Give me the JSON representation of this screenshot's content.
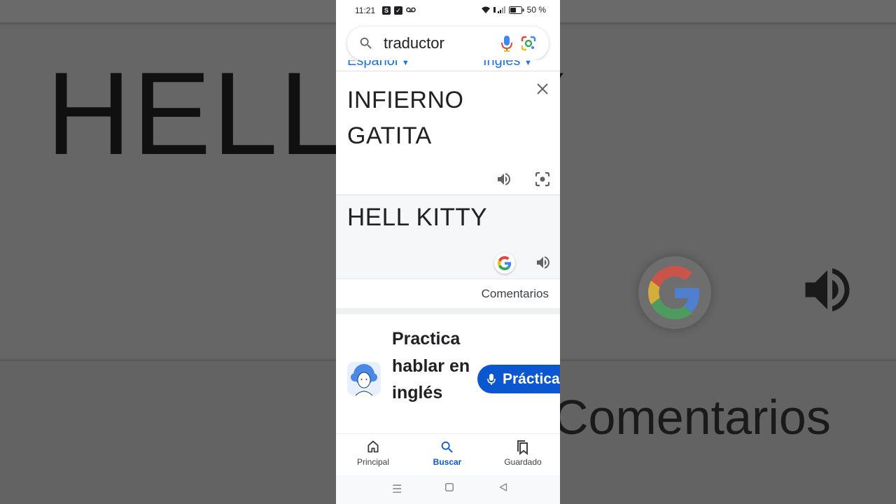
{
  "status": {
    "time": "11:21",
    "battery": "50 %"
  },
  "search": {
    "query": "traductor"
  },
  "translator": {
    "source_lang": "Español",
    "target_lang": "Inglés",
    "source_text": "INFIERNO GATITA",
    "target_text": "HELL KITTY",
    "comments_label": "Comentarios"
  },
  "practice": {
    "title": "Practica hablar en inglés",
    "button_label": "Práctica"
  },
  "nav": {
    "items": [
      {
        "label": "Principal",
        "icon": "home-icon"
      },
      {
        "label": "Buscar",
        "icon": "search-icon",
        "active": true
      },
      {
        "label": "Guardado",
        "icon": "bookmarks-icon"
      }
    ]
  },
  "background": {
    "big_text": "HELL K    Y",
    "comments_big": "Comentarios"
  },
  "colors": {
    "accent": "#1a73e8",
    "button": "#0b57d0",
    "google_blue": "#4285F4",
    "google_red": "#EA4335",
    "google_yellow": "#FBBC05",
    "google_green": "#34A853"
  }
}
